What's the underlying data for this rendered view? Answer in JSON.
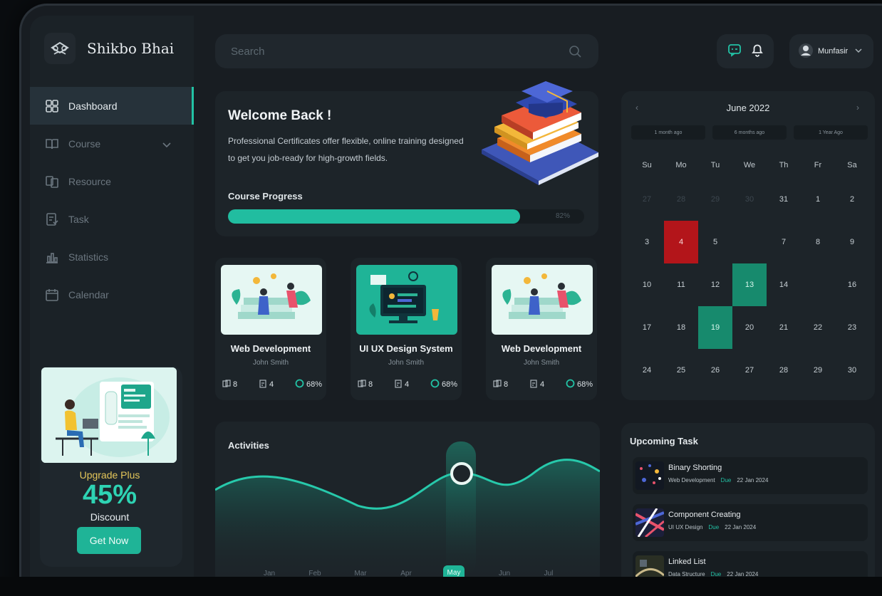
{
  "brand": {
    "name": "Shikbo Bhai"
  },
  "search": {
    "placeholder": "Search"
  },
  "user": {
    "name": "Munfasir"
  },
  "sidebar": {
    "items": [
      {
        "label": "Dashboard",
        "icon": "dashboard-icon",
        "active": true
      },
      {
        "label": "Course",
        "icon": "book-icon",
        "has_submenu": true
      },
      {
        "label": "Resource",
        "icon": "resource-icon"
      },
      {
        "label": "Task",
        "icon": "task-icon"
      },
      {
        "label": "Statistics",
        "icon": "statistics-icon"
      },
      {
        "label": "Calendar",
        "icon": "calendar-icon"
      }
    ]
  },
  "promo": {
    "title": "Upgrade Plus",
    "percent": "45%",
    "subtitle": "Discount",
    "button": "Get Now"
  },
  "welcome": {
    "title": "Welcome Back !",
    "text": "Professional Certificates offer flexible, online training designed to get you job-ready for high-growth fields.",
    "progress_label": "Course Progress",
    "progress_value": "82%",
    "progress_fraction": 0.82
  },
  "courses": [
    {
      "title": "Web Development",
      "author": "John Smith",
      "lessons": "8",
      "tasks": "4",
      "progress": "68%"
    },
    {
      "title": "UI UX Design System",
      "author": "John Smith",
      "lessons": "8",
      "tasks": "4",
      "progress": "68%"
    },
    {
      "title": "Web Development",
      "author": "John Smith",
      "lessons": "8",
      "tasks": "4",
      "progress": "68%"
    }
  ],
  "activities": {
    "title": "Activities",
    "months": [
      "Jan",
      "Feb",
      "Mar",
      "Apr",
      "May",
      "Jun",
      "Jul"
    ],
    "selected_month": "May"
  },
  "calendar": {
    "title": "June 2022",
    "prev": "‹",
    "next": "›",
    "chips": [
      "1 month ago",
      "6 months ago",
      "1 Year Ago"
    ],
    "days_of_week": [
      "Su",
      "Mo",
      "Tu",
      "We",
      "Th",
      "Fr",
      "Sa"
    ],
    "weeks": [
      [
        "27",
        "28",
        "29",
        "30",
        "31",
        "1",
        "2"
      ],
      [
        "3",
        "4",
        "5",
        "",
        "7",
        "8",
        "9"
      ],
      [
        "10",
        "11",
        "12",
        "13",
        "14",
        "",
        "16"
      ],
      [
        "17",
        "18",
        "19",
        "20",
        "21",
        "22",
        "23"
      ],
      [
        "24",
        "25",
        "26",
        "27",
        "28",
        "29",
        "30"
      ]
    ],
    "highlight_red": "4",
    "highlight_green": [
      "13",
      "19"
    ]
  },
  "upcoming": {
    "title": "Upcoming Task",
    "tasks": [
      {
        "name": "Binary Shorting",
        "category": "Web Development",
        "due_label": "Due",
        "date": "22 Jan 2024"
      },
      {
        "name": "Component Creating",
        "category": "UI UX Design",
        "due_label": "Due",
        "date": "22 Jan 2024"
      },
      {
        "name": "Linked List",
        "category": "Data Structure",
        "due_label": "Due",
        "date": "22 Jan 2024"
      }
    ]
  },
  "colors": {
    "accent": "#22c2a5",
    "highlight_red": "#b3151a",
    "highlight_green": "#178a6d"
  }
}
